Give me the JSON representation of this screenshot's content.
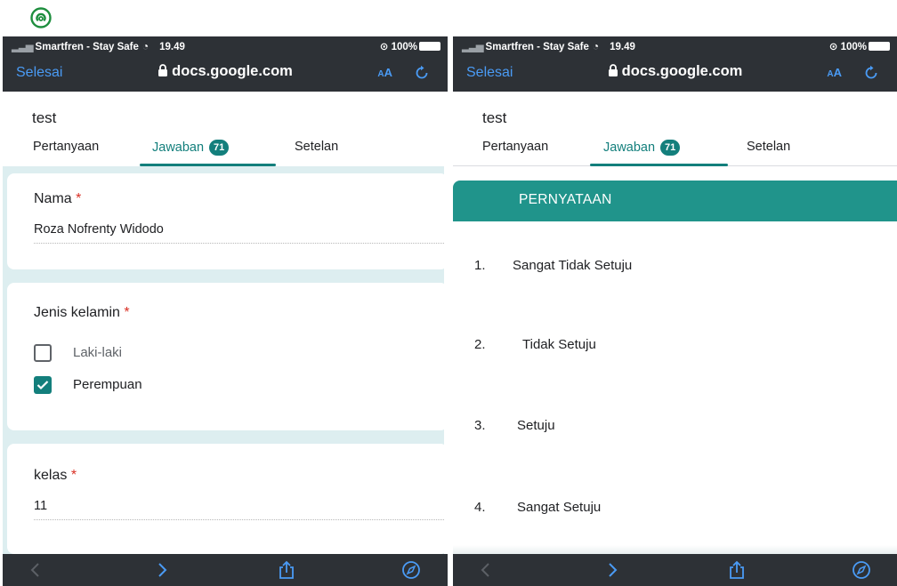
{
  "colors": {
    "accent": "#137f7c",
    "header_green": "#20948b",
    "link_blue": "#4a9bf5",
    "browser_chrome": "#2d3136",
    "required": "#d93025"
  },
  "icons": {
    "top": "chat-bubble-icon",
    "lock": "lock-icon",
    "reload": "reload-icon",
    "back": "chevron-left-icon",
    "forward": "chevron-right-icon",
    "share": "share-icon",
    "compass": "compass-icon",
    "check": "check-icon"
  },
  "status": {
    "carrier": "Smartfren - Stay Safe",
    "time": "19.49",
    "battery": "100%"
  },
  "browser": {
    "done": "Selesai",
    "url": "docs.google.com",
    "aa_small": "A",
    "aa_large": "A"
  },
  "form": {
    "title": "test",
    "tabs": [
      {
        "label": "Pertanyaan"
      },
      {
        "label": "Jawaban",
        "badge": "71"
      },
      {
        "label": "Setelan"
      }
    ]
  },
  "left": {
    "nama": {
      "label": "Nama",
      "required": "*",
      "value": "Roza Nofrenty Widodo"
    },
    "jenis": {
      "label": "Jenis kelamin",
      "required": "*",
      "options": [
        {
          "label": "Laki-laki",
          "checked": false
        },
        {
          "label": "Perempuan",
          "checked": true
        }
      ]
    },
    "kelas": {
      "label": "kelas",
      "required": "*",
      "value": "11"
    }
  },
  "right": {
    "header": "PERNYATAAN",
    "items": [
      {
        "num": "1.",
        "text": "Sangat Tidak Setuju"
      },
      {
        "num": "2.",
        "text": "Tidak Setuju"
      },
      {
        "num": "3.",
        "text": "Setuju"
      },
      {
        "num": "4.",
        "text": "Sangat  Setuju"
      }
    ]
  }
}
